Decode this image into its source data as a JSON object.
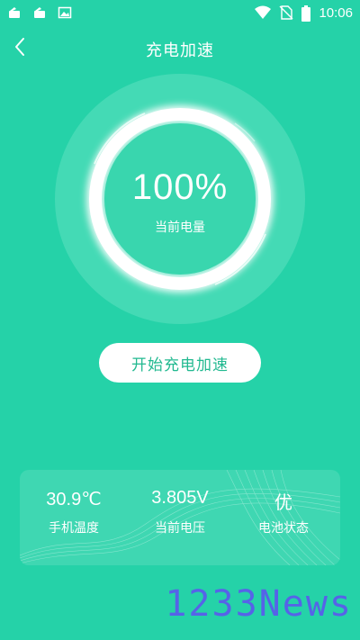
{
  "status_bar": {
    "time": "10:06",
    "left_icons": [
      "download-notification-icon",
      "download-notification-icon",
      "image-notification-icon"
    ],
    "right_icons": [
      "wifi-icon",
      "no-sim-icon",
      "battery-icon"
    ]
  },
  "header": {
    "back_icon": "chevron-left-icon",
    "title": "充电加速"
  },
  "gauge": {
    "percent_text": "100%",
    "label": "当前电量",
    "level": 1.0
  },
  "actions": {
    "start_label": "开始充电加速"
  },
  "stats": [
    {
      "value": "30.9℃",
      "label": "手机温度"
    },
    {
      "value": "3.805V",
      "label": "当前电压"
    },
    {
      "value": "优",
      "label": "电池状态"
    }
  ],
  "watermark": "1233News",
  "colors": {
    "background": "#25d2a8",
    "button_text": "#22b990",
    "watermark": "#5663e8"
  }
}
